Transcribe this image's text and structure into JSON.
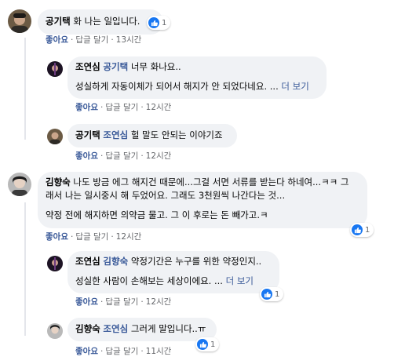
{
  "comments": [
    {
      "author": "공기택",
      "mention": "",
      "lines": [
        "화 나는 일입니다."
      ],
      "more": "",
      "reaction_count": "1",
      "like_label": "좋아요",
      "reply_label": "답글 달기",
      "time": "13시간"
    },
    {
      "author": "조연심",
      "mention": "공기택",
      "lines": [
        "너무 화나요..",
        "성실하게 자동이체가 되어서 해지가 안 되었다네요. ..."
      ],
      "more": "더 보기",
      "like_label": "좋아요",
      "reply_label": "답글 달기",
      "time": "12시간"
    },
    {
      "author": "공기택",
      "mention": "조연심",
      "lines": [
        "헐 말도 안되는 이야기죠"
      ],
      "more": "",
      "like_label": "좋아요",
      "reply_label": "답글 달기",
      "time": "12시간"
    },
    {
      "author": "김향숙",
      "mention": "",
      "lines": [
        "나도 방금 에그 해지건 때문에...그걸 서면 서류를 받는다 하네여...ㅋㅋ 그",
        "래서 나는 일시중시 해 두었어요. 그래도 3천원씩 나간다는 것...",
        "약정 전에 해지하면 의약금 물고. 그 이 후로는 돈 빼가고.ㅋ"
      ],
      "more": "",
      "reaction_count": "1",
      "like_label": "좋아요",
      "reply_label": "답글 달기",
      "time": "12시간"
    },
    {
      "author": "조연심",
      "mention": "김향숙",
      "lines": [
        "약정기간은 누구를 위한 약정인지..",
        "성실한 사람이 손해보는 세상이에요. ..."
      ],
      "more": "더 보기",
      "reaction_count": "1",
      "like_label": "좋아요",
      "reply_label": "답글 달기",
      "time": "12시간"
    },
    {
      "author": "김향숙",
      "mention": "조연심",
      "lines": [
        "그러게 말입니다..ㅠ"
      ],
      "more": "",
      "reaction_count": "1",
      "like_label": "좋아요",
      "reply_label": "답글 달기",
      "time": "11시간"
    }
  ],
  "separator": "·",
  "colors": {
    "link": "#385898",
    "bubble": "#f0f2f5",
    "like_blue": "#1877f2",
    "meta": "#65676b"
  },
  "icons": {
    "reaction": "like-thumb-icon"
  }
}
